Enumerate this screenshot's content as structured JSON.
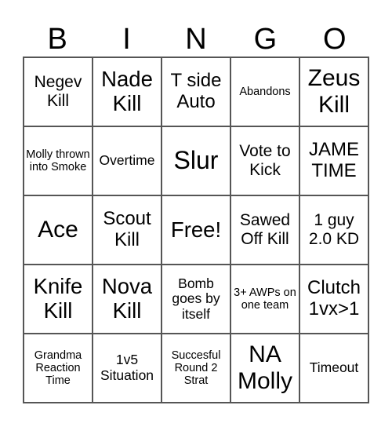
{
  "header": {
    "letters": [
      "B",
      "I",
      "N",
      "G",
      "O"
    ]
  },
  "board": {
    "rows": [
      [
        "Negev Kill",
        "Nade Kill",
        "T side Auto",
        "Abandons",
        "Zeus Kill"
      ],
      [
        "Molly thrown into Smoke",
        "Overtime",
        "Slur",
        "Vote to Kick",
        "JAME TIME"
      ],
      [
        "Ace",
        "Scout Kill",
        "Free!",
        "Sawed Off Kill",
        "1 guy 2.0 KD"
      ],
      [
        "Knife Kill",
        "Nova Kill",
        "Bomb goes by itself",
        "3+ AWPs on one team",
        "Clutch 1vx>1"
      ],
      [
        "Grandma Reaction Time",
        "1v5 Situation",
        "Succesful Round 2 Strat",
        "NA Molly",
        "Timeout"
      ]
    ],
    "free_space": "Free!"
  }
}
